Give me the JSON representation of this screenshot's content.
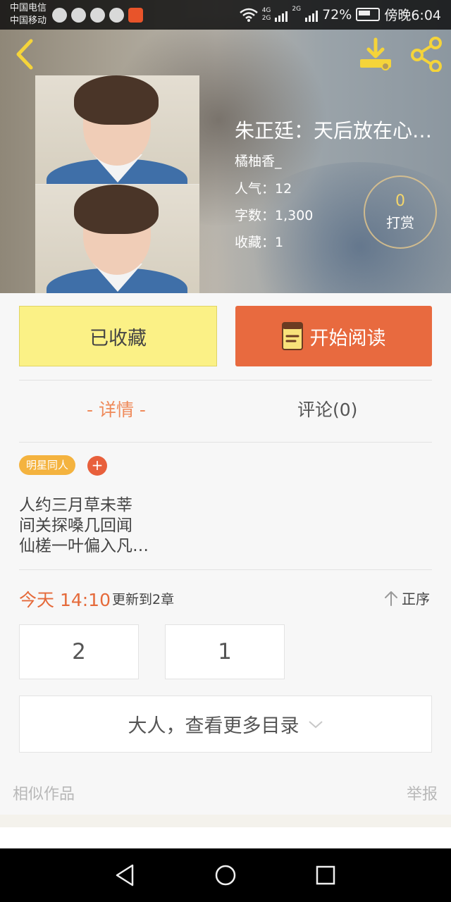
{
  "status_bar": {
    "carrier1": "中国电信",
    "carrier2": "中国移动",
    "network1": "4G",
    "network2": "2G",
    "network3": "2G",
    "battery": "72%",
    "time": "傍晚6:04",
    "icons": [
      "wifi-icon",
      "signal-icon",
      "battery-icon"
    ]
  },
  "header": {
    "back_icon": "back-chevron-icon",
    "download_icon": "download-icon",
    "share_icon": "share-icon"
  },
  "book": {
    "title": "朱正廷：天后放在心…",
    "author": "橘柚香_",
    "popularity": "人气：12",
    "word_count": "字数：1,300",
    "favorites": "收藏：1",
    "tip_count": "0",
    "tip_label": "打赏"
  },
  "actions": {
    "favorited_label": "已收藏",
    "read_label": "开始阅读"
  },
  "tabs": {
    "detail": "- 详情 -",
    "comments": "评论(0)"
  },
  "tags": {
    "items": [
      "明星同人"
    ],
    "add": "+"
  },
  "intro": {
    "lines": [
      "人约三月草未莘",
      "间关探嗓几回闻",
      "仙槎一叶偏入凡…"
    ]
  },
  "update": {
    "time": "今天 14:10",
    "text": "更新到2章",
    "sort_label": "正序"
  },
  "chapters": [
    "2",
    "1"
  ],
  "more_catalog": "大人，查看更多目录",
  "footer": {
    "similar": "相似作品",
    "report": "举报"
  },
  "colors": {
    "accent_orange": "#e86a3f",
    "favorite_yellow": "#fbf186",
    "tag_yellow": "#f4b33f"
  }
}
